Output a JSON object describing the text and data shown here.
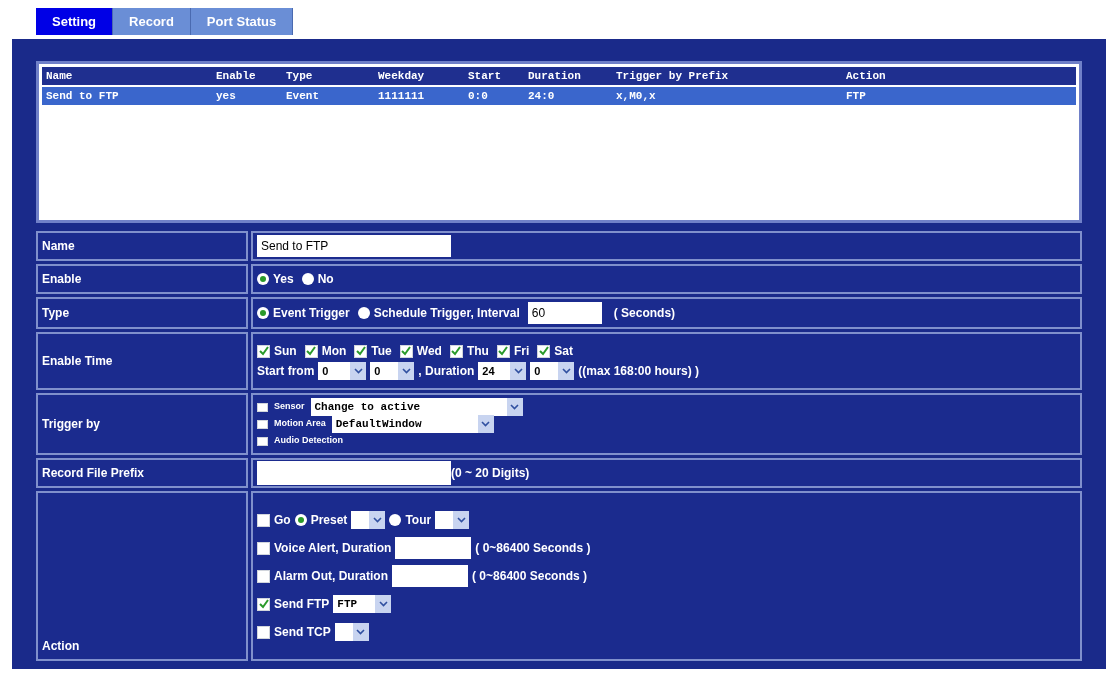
{
  "tabs": [
    {
      "label": "Setting",
      "selected": true
    },
    {
      "label": "Record",
      "selected": false
    },
    {
      "label": "Port Status",
      "selected": false
    }
  ],
  "event_list": {
    "columns": [
      "Name",
      "Enable",
      "Type",
      "Weekday",
      "Start",
      "Duration",
      "Trigger by Prefix",
      "Action"
    ],
    "rows": [
      {
        "cells": [
          "Send to FTP",
          "yes",
          "Event",
          "1111111",
          "0:0",
          "24:0",
          "x,M0,x",
          "FTP"
        ],
        "selected": true
      }
    ]
  },
  "name": {
    "label": "Name",
    "value": "Send to FTP"
  },
  "enable": {
    "label": "Enable",
    "options": [
      {
        "label": "Yes",
        "selected": true
      },
      {
        "label": "No",
        "selected": false
      }
    ]
  },
  "type": {
    "label": "Type",
    "options": [
      {
        "label": "Event Trigger",
        "selected": true
      },
      {
        "label": "Schedule Trigger, Interval",
        "selected": false
      }
    ],
    "interval": "60",
    "unit": "( Seconds)"
  },
  "enable_time": {
    "label": "Enable Time",
    "days": [
      {
        "label": "Sun",
        "checked": true
      },
      {
        "label": "Mon",
        "checked": true
      },
      {
        "label": "Tue",
        "checked": true
      },
      {
        "label": "Wed",
        "checked": true
      },
      {
        "label": "Thu",
        "checked": true
      },
      {
        "label": "Fri",
        "checked": true
      },
      {
        "label": "Sat",
        "checked": true
      }
    ],
    "start_label": "Start from",
    "start_hour": "0",
    "start_minute": "0",
    "duration_label": ", Duration",
    "duration_hour": "24",
    "duration_minute": "0",
    "note": "((max 168:00 hours) )"
  },
  "trigger_by": {
    "label": "Trigger by",
    "items": [
      {
        "label": "Sensor",
        "checked": false,
        "select": "Change to active"
      },
      {
        "label": "Motion Area",
        "checked": false,
        "select": "DefaultWindow"
      },
      {
        "label": "Audio Detection",
        "checked": false
      }
    ]
  },
  "record_file_prefix": {
    "label": "Record File Prefix",
    "hint": "(0 ~ 20 Digits)"
  },
  "action": {
    "label": "Action",
    "items": [
      {
        "kind": "go",
        "label": "Go",
        "checked": false,
        "options": [
          {
            "label": "Preset",
            "selected": true
          },
          {
            "label": "Tour",
            "selected": false
          }
        ]
      },
      {
        "kind": "duration",
        "label": "Voice Alert, Duration",
        "checked": false,
        "hint": "( 0~86400 Seconds )"
      },
      {
        "kind": "duration",
        "label": "Alarm Out, Duration",
        "checked": false,
        "hint": "( 0~86400 Seconds )"
      },
      {
        "kind": "send",
        "label": "Send FTP",
        "checked": true,
        "select": "FTP"
      },
      {
        "kind": "send",
        "label": "Send TCP",
        "checked": false
      }
    ]
  }
}
